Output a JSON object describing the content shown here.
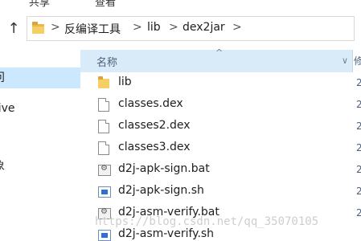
{
  "ribbon": {
    "tabs": [
      "共享",
      "查看"
    ]
  },
  "address_bar": {
    "breadcrumbs": [
      "反编译工具",
      "lib",
      "dex2jar"
    ],
    "separator": ">",
    "dropdown": "⌄"
  },
  "nav_pane": {
    "items": [
      {
        "label": "问",
        "selected": true
      },
      {
        "label": "rive",
        "selected": false
      },
      {
        "label": "象",
        "selected": false
      }
    ]
  },
  "file_list": {
    "column_header": "名称",
    "sort_indicator": "^",
    "column_dropdown": "∨",
    "next_column_label": "修",
    "files": [
      {
        "name": "lib",
        "type": "folder"
      },
      {
        "name": "classes.dex",
        "type": "dex"
      },
      {
        "name": "classes2.dex",
        "type": "dex"
      },
      {
        "name": "classes3.dex",
        "type": "dex"
      },
      {
        "name": "d2j-apk-sign.bat",
        "type": "bat"
      },
      {
        "name": "d2j-apk-sign.sh",
        "type": "sh"
      },
      {
        "name": "d2j-asm-verify.bat",
        "type": "bat"
      },
      {
        "name": "d2j-asm-verify.sh",
        "type": "sh"
      }
    ],
    "row_trunc_char": "2"
  },
  "watermark": "https://blog.csdn.net/qq_35070105",
  "colors": {
    "header_bg": "#d9ebf9",
    "selected_bg": "#cce8ff",
    "folder": "#f5cf64"
  }
}
